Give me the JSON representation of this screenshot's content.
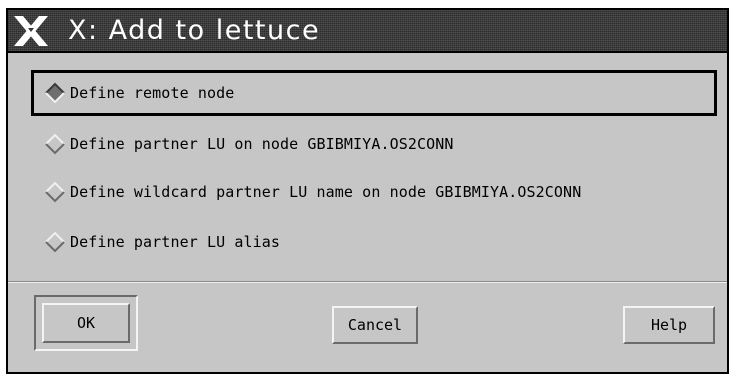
{
  "window": {
    "title": "X: Add to lettuce"
  },
  "options": [
    {
      "label": "Define remote node",
      "selected": true
    },
    {
      "label": "Define partner LU on node GBIBMIYA.OS2CONN",
      "selected": false
    },
    {
      "label": "Define wildcard partner LU name on node GBIBMIYA.OS2CONN",
      "selected": false
    },
    {
      "label": "Define partner LU alias",
      "selected": false
    }
  ],
  "buttons": {
    "ok": "OK",
    "cancel": "Cancel",
    "help": "Help"
  },
  "icons": {
    "window_logo": "x-logo-icon",
    "radio": "diamond-radio-icon"
  },
  "colors": {
    "background": "#c6c6c6",
    "titlebar": "#3a3a3a",
    "title_text": "#ffffff",
    "text": "#000000"
  }
}
